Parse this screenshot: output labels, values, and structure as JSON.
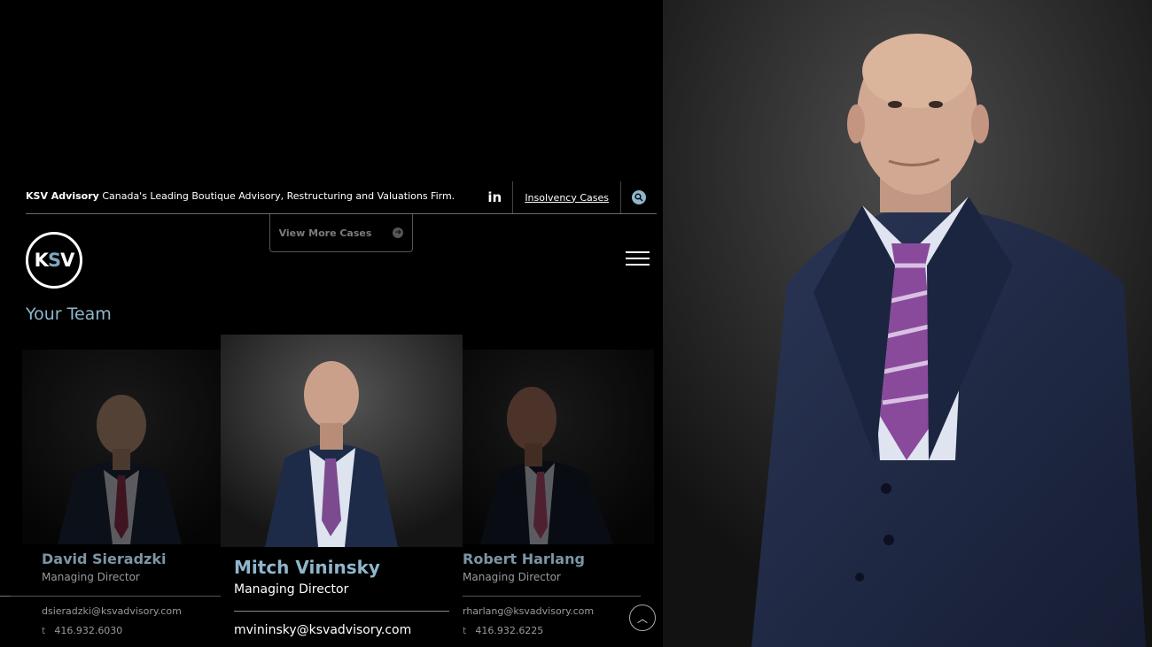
{
  "header": {
    "brand_name": "KSV Advisory",
    "tagline": "Canada's Leading Boutique Advisory, Restructuring and Valuations Firm.",
    "linkedin_label": "in",
    "insolvency_link": "Insolvency Cases"
  },
  "view_more": {
    "label": "View More Cases"
  },
  "logo": {
    "k": "K",
    "s": "S",
    "v": "V"
  },
  "section": {
    "title": "Your Team"
  },
  "team": [
    {
      "name": "David Sieradzki",
      "role": "Managing Director",
      "email": "dsieradzki@ksvadvisory.com",
      "phone_prefix": "t",
      "phone": "416.932.6030"
    },
    {
      "name": "Mitch Vininsky",
      "role": "Managing Director",
      "email": "mvininsky@ksvadvisory.com",
      "phone_prefix": "",
      "phone": ""
    },
    {
      "name": "Robert Harlang",
      "role": "Managing Director",
      "email": "rharlang@ksvadvisory.com",
      "phone_prefix": "t",
      "phone": "416.932.6225"
    }
  ],
  "colors": {
    "accent": "#8fb6cc",
    "name_dim": "#7d95a5",
    "background": "#000000"
  }
}
